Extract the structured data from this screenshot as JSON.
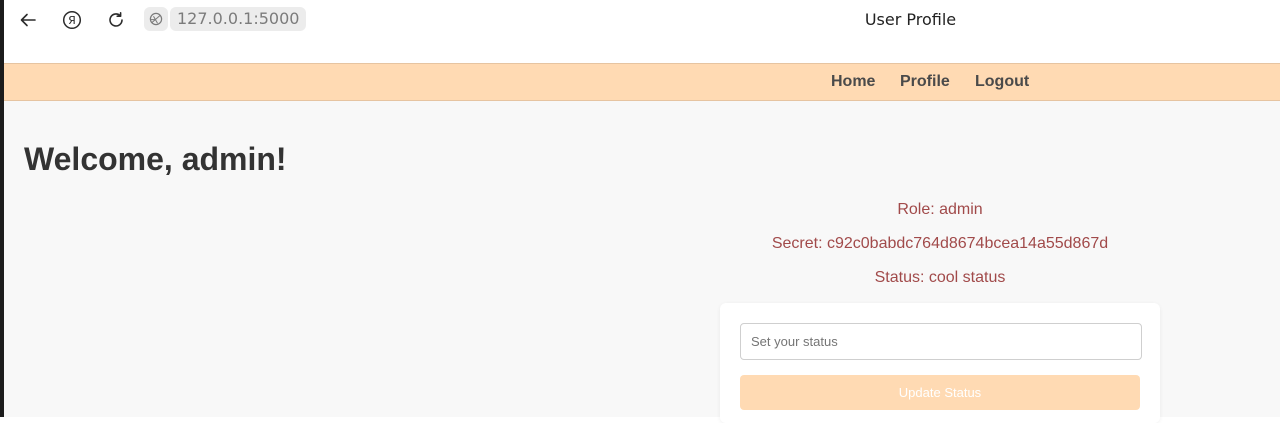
{
  "browser": {
    "url": "127.0.0.1:5000",
    "tab_title": "User Profile",
    "icons": [
      "back-arrow-icon",
      "yandex-icon",
      "reload-icon",
      "site-info-icon"
    ]
  },
  "nav": {
    "home": "Home",
    "profile": "Profile",
    "logout": "Logout"
  },
  "page": {
    "welcome": "Welcome, admin!",
    "role": "Role: admin",
    "secret": "Secret: c92c0babdc764d8674bcea14a55d867d",
    "status": "Status: cool status"
  },
  "form": {
    "status_placeholder": "Set your status",
    "status_value": "",
    "update_label": "Update Status"
  },
  "colors": {
    "nav_bg": "#ffdab3",
    "info_text": "#a14a4a",
    "heading": "#333333",
    "content_bg": "#f8f8f8"
  }
}
